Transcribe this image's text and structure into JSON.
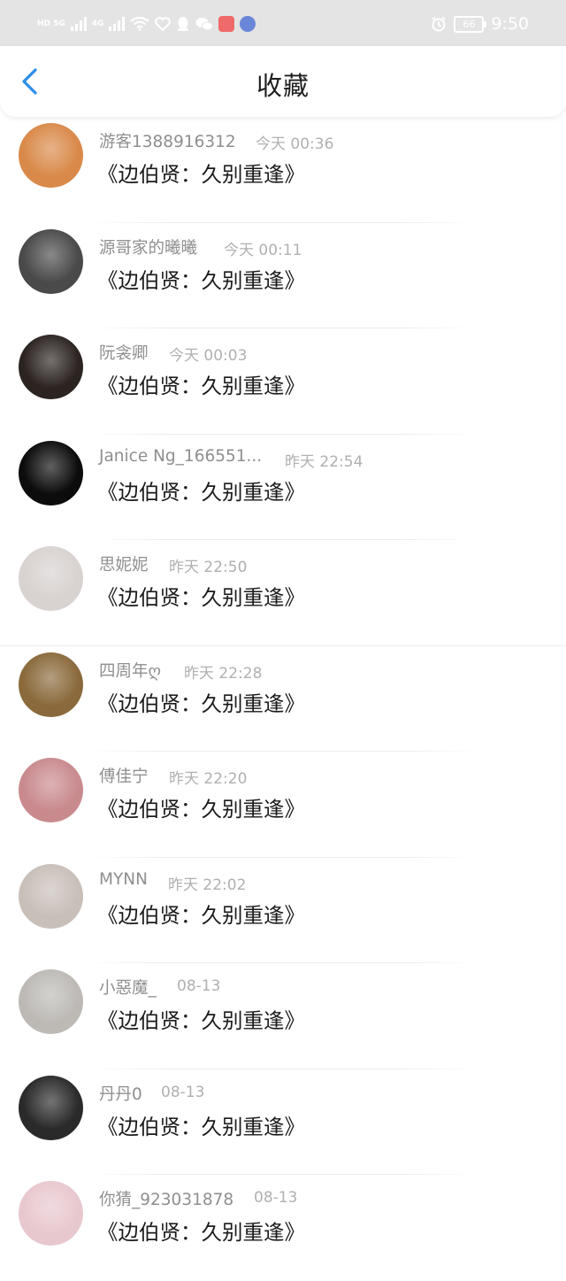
{
  "status_bar": {
    "left_tags": [
      "HD 5G",
      "4G"
    ],
    "battery": "66",
    "time": "9:50"
  },
  "header": {
    "title": "收藏"
  },
  "items": [
    {
      "name": "游客1388916312",
      "time": "今天 00:36",
      "content": "《边伯贤：久别重逢》",
      "avatar_color": "#d98a4a"
    },
    {
      "name": "源哥家的曦曦",
      "time": "今天 00:11",
      "content": "《边伯贤：久别重逢》",
      "avatar_color": "#4a4a4a"
    },
    {
      "name": "阮衾卿",
      "time": "今天 00:03",
      "content": "《边伯贤：久别重逢》",
      "avatar_color": "#2c2421"
    },
    {
      "name": "Janice Ng_166551...",
      "time": "昨天 22:54",
      "content": "《边伯贤：久别重逢》",
      "avatar_color": "#0c0c0c"
    },
    {
      "name": "思妮妮",
      "time": "昨天 22:50",
      "content": "《边伯贤：久别重逢》",
      "avatar_color": "#d8d2d0"
    },
    {
      "name": "四周年ღ",
      "time": "昨天 22:28",
      "content": "《边伯贤：久别重逢》",
      "avatar_color": "#8a6a3c"
    },
    {
      "name": "傅佳宁",
      "time": "昨天 22:20",
      "content": "《边伯贤：久别重逢》",
      "avatar_color": "#c98a8e"
    },
    {
      "name": "MYNN",
      "time": "昨天 22:02",
      "content": "《边伯贤：久别重逢》",
      "avatar_color": "#c9bfb9"
    },
    {
      "name": "小惡魔_",
      "time": "08-13",
      "content": "《边伯贤：久别重逢》",
      "avatar_color": "#bdbab6"
    },
    {
      "name": "丹丹0",
      "time": "08-13",
      "content": "《边伯贤：久别重逢》",
      "avatar_color": "#2a2a2a"
    },
    {
      "name": "你猜_923031878",
      "time": "08-13",
      "content": "《边伯贤：久别重逢》",
      "avatar_color": "#e8c8cf"
    }
  ]
}
